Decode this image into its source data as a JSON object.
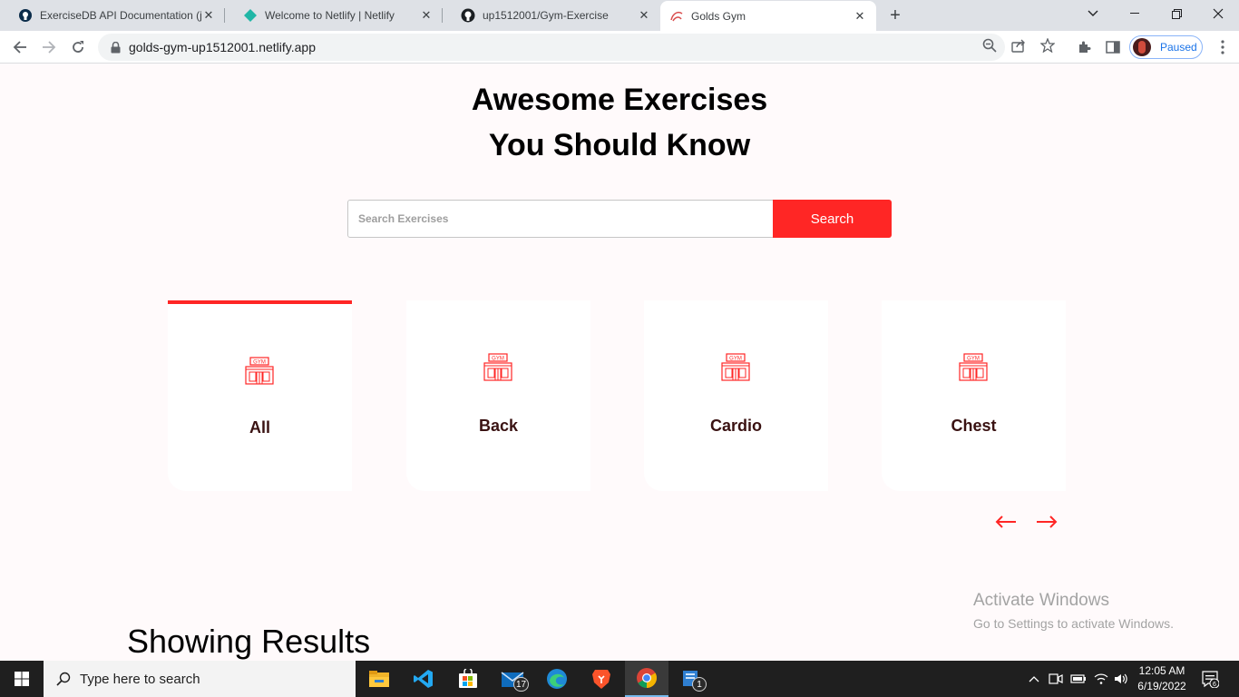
{
  "browser": {
    "tabs": [
      {
        "title": "ExerciseDB API Documentation (j",
        "icon": "rapidapi-icon",
        "active": false
      },
      {
        "title": "Welcome to Netlify | Netlify",
        "icon": "netlify-icon",
        "active": false
      },
      {
        "title": "up1512001/Gym-Exercise",
        "icon": "github-icon",
        "active": false
      },
      {
        "title": "Golds Gym",
        "icon": "golds-gym-icon",
        "active": true
      }
    ],
    "url": "golds-gym-up1512001.netlify.app",
    "profile_label": "Paused"
  },
  "page": {
    "hero_line1": "Awesome Exercises",
    "hero_line2": "You Should Know",
    "search": {
      "placeholder": "Search Exercises",
      "value": "",
      "button_label": "Search"
    },
    "body_parts": [
      {
        "label": "All",
        "selected": true
      },
      {
        "label": "Back",
        "selected": false
      },
      {
        "label": "Cardio",
        "selected": false
      },
      {
        "label": "Chest",
        "selected": false
      }
    ],
    "results_heading": "Showing Results",
    "accent_color": "#ff2625"
  },
  "watermark": {
    "line1": "Activate Windows",
    "line2": "Go to Settings to activate Windows."
  },
  "taskbar": {
    "search_placeholder": "Type here to search",
    "mail_badge": "17",
    "notes_badge": "1",
    "time": "12:05 AM",
    "date": "6/19/2022",
    "notification_count": "6"
  }
}
